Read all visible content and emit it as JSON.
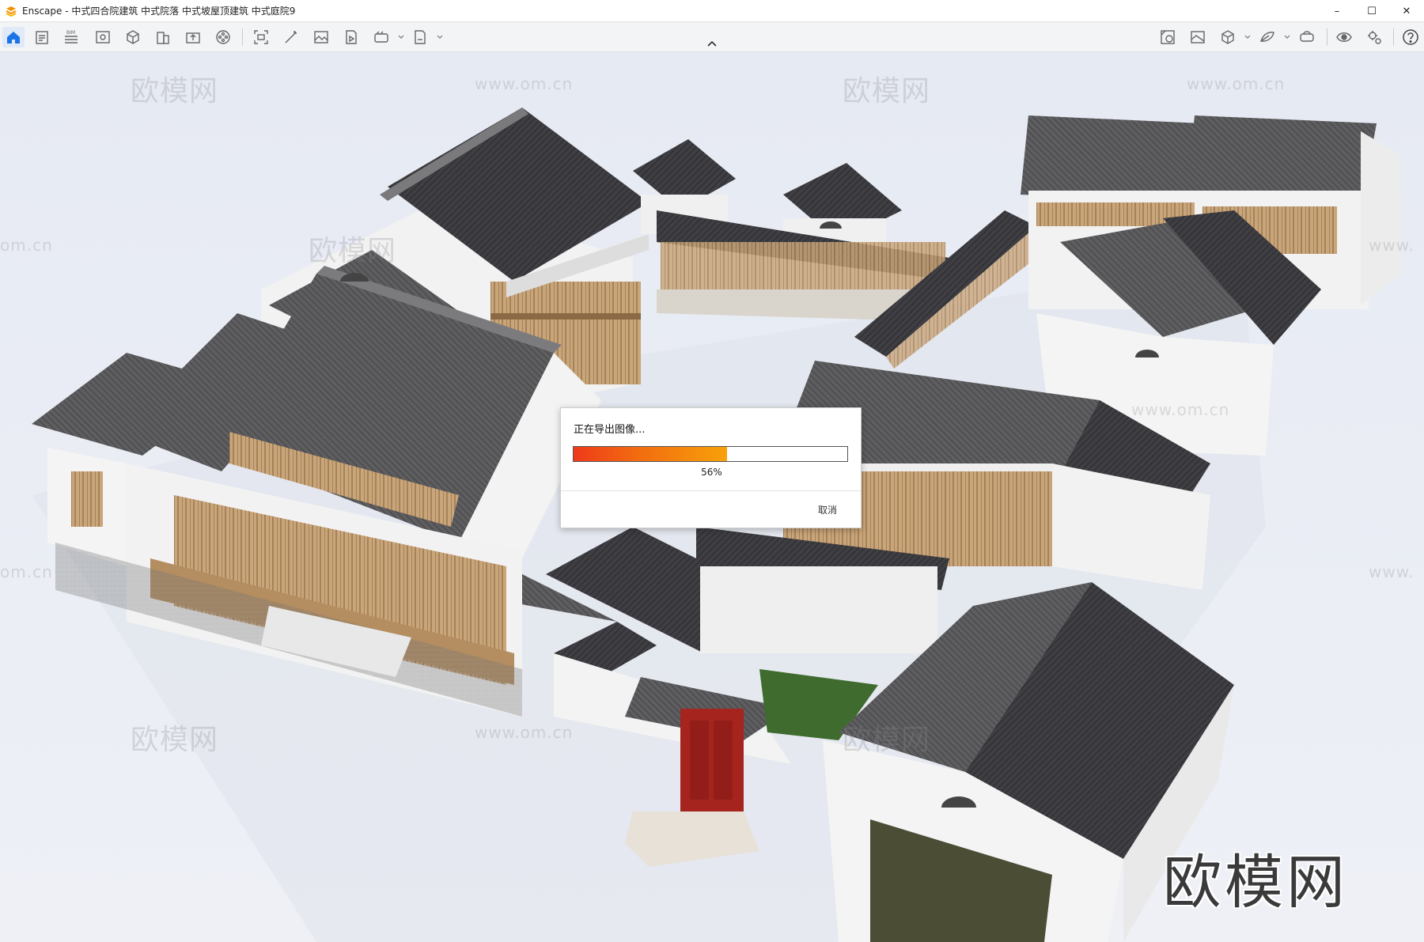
{
  "window": {
    "title": "Enscape - 中式四合院建筑 中式院落 中式坡屋顶建筑 中式庭院9",
    "controls": {
      "minimize": "–",
      "maximize": "☐",
      "close": "✕"
    }
  },
  "toolbar": {
    "bim_label": "BIM",
    "left_icons": [
      "home-icon",
      "notes-icon",
      "bim-icon",
      "views-icon",
      "asset-library-icon",
      "building-icon",
      "upload-icon",
      "video-editor-icon",
      "capture-icon",
      "atmosphere-icon",
      "screenshot-icon",
      "batch-render-icon",
      "panorama-icon",
      "export-icon"
    ],
    "right_icons": [
      "material-editor-icon",
      "visual-settings-icon",
      "cube-icon",
      "site-context-icon",
      "vr-headset-icon",
      "eye-icon",
      "settings-icon",
      "help-icon"
    ]
  },
  "watermarks": {
    "logo_text": "欧模网",
    "url_text": "www.om.cn",
    "url_fragment": "om.cn",
    "url_prefix": "www."
  },
  "dialog": {
    "message": "正在导出图像...",
    "progress_percent": 56,
    "progress_label": "56%",
    "cancel_label": "取消"
  },
  "colors": {
    "accent": "#1a73e8",
    "progress_start": "#ee3a1a",
    "progress_end": "#f7a10a",
    "roof": "#5a5a5c",
    "wall": "#f3f3f3",
    "wood": "#b08a5a",
    "door": "#a5241d",
    "grass": "#3f6b2e"
  }
}
